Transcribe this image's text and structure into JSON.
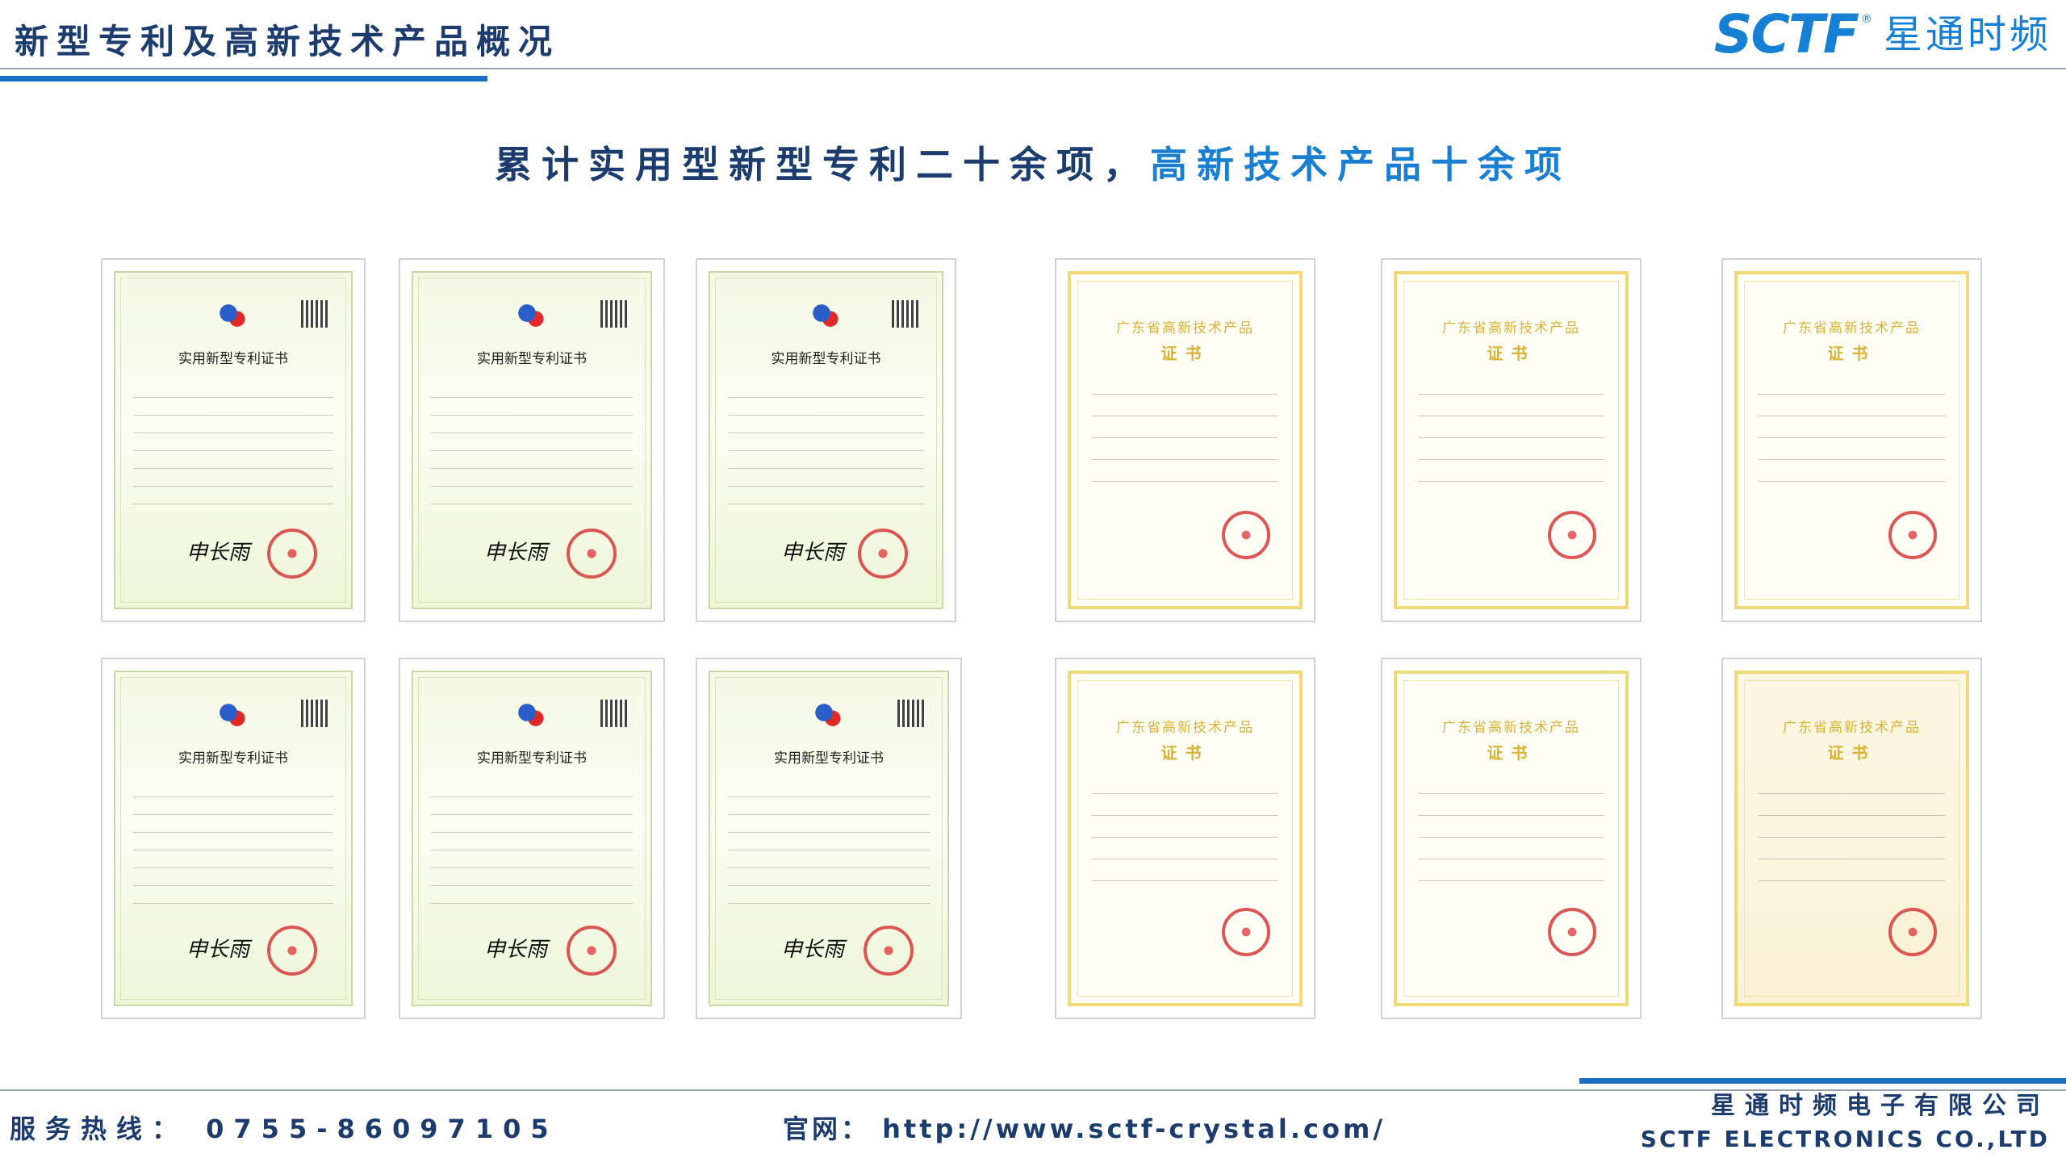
{
  "header": {
    "title": "新型专利及高新技术产品概况"
  },
  "logo": {
    "mark": "SCTF",
    "reg": "®",
    "name_cn": "星通时频"
  },
  "headline": {
    "part1": "累计实用型新型专利二十余项，",
    "part2": "高新技术产品十余项"
  },
  "patent_certificate": {
    "title": "实用新型专利证书"
  },
  "hitech_certificate": {
    "title": "广东省高新技术产品",
    "subtitle": "证书"
  },
  "footer": {
    "hotline": "服务热线： 0755-86097105",
    "website": "官网： http://www.sctf-crystal.com/",
    "company_cn": "星通时频电子有限公司",
    "company_en": "SCTF ELECTRONICS CO.,LTD"
  },
  "colors": {
    "navy": "#1d3c6e",
    "blue": "#1a7fd0",
    "gold": "#d9b233"
  }
}
